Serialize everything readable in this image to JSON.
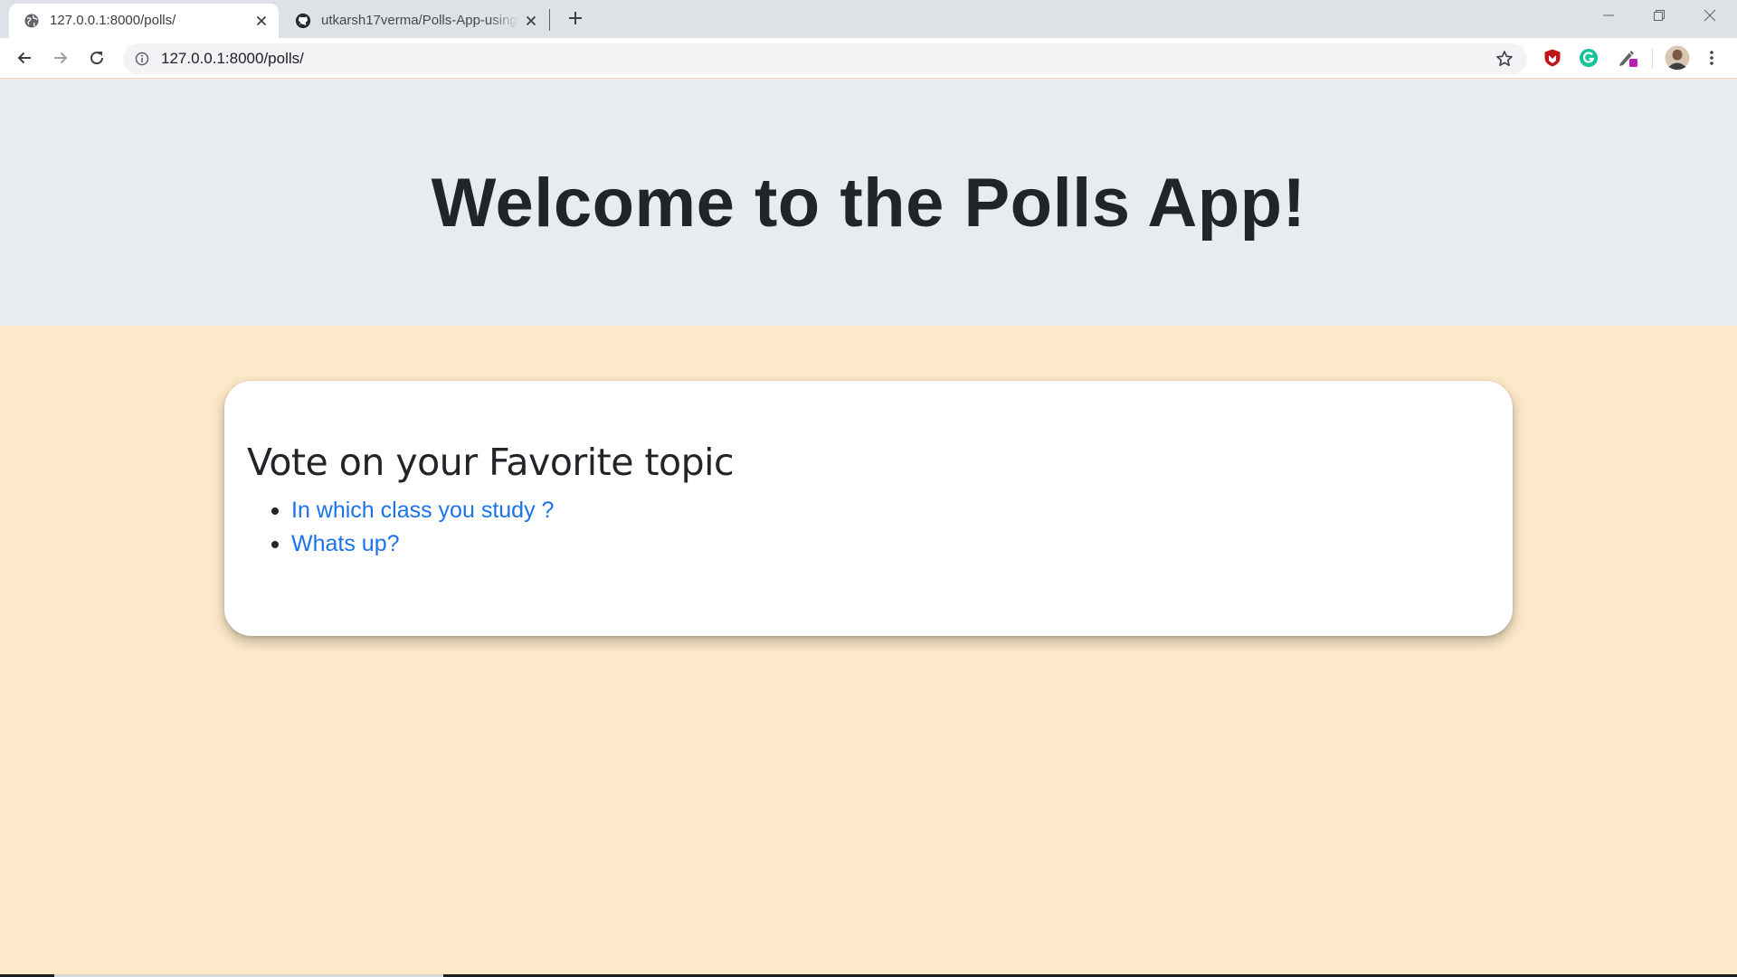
{
  "browser": {
    "tabs": [
      {
        "title": "127.0.0.1:8000/polls/",
        "favicon": "globe-icon",
        "active": true
      },
      {
        "title": "utkarsh17verma/Polls-App-using",
        "favicon": "github-icon",
        "active": false
      }
    ],
    "address": "127.0.0.1:8000/polls/",
    "extensions": [
      "mcafee-shield-icon",
      "grammarly-icon",
      "pen-extension-icon",
      "profile-avatar"
    ]
  },
  "page": {
    "hero_title": "Welcome to the Polls App!",
    "card": {
      "heading": "Vote on your Favorite topic",
      "polls": [
        {
          "question": "In which class you study ?"
        },
        {
          "question": "Whats up?"
        }
      ]
    }
  },
  "colors": {
    "page_background": "#fde9c9",
    "jumbotron_background": "#e9ecef",
    "link": "#1a73e8",
    "text": "#212529"
  }
}
